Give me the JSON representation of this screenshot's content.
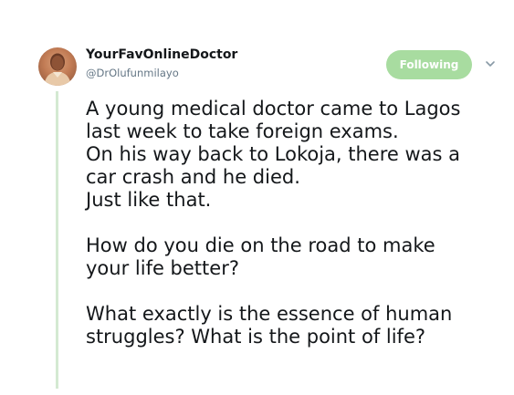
{
  "user": {
    "display_name": "YourFavOnlineDoctor",
    "handle": "@DrOlufunmilayo"
  },
  "follow_button": {
    "label": "Following",
    "color": "#a8dca0"
  },
  "icons": {
    "avatar": "profile-photo",
    "menu": "chevron-down-icon"
  },
  "tweet": {
    "paragraphs": [
      {
        "lines": [
          "A young medical doctor came to Lagos",
          "last week to take foreign exams.",
          "On his way back to Lokoja, there was a",
          "car crash and he died.",
          "Just like that."
        ]
      },
      {
        "lines": [
          "How do you die on the road to make",
          "your life better?"
        ]
      },
      {
        "lines": [
          "What exactly is the essence of human",
          "struggles? What is the point of life?"
        ]
      }
    ]
  }
}
